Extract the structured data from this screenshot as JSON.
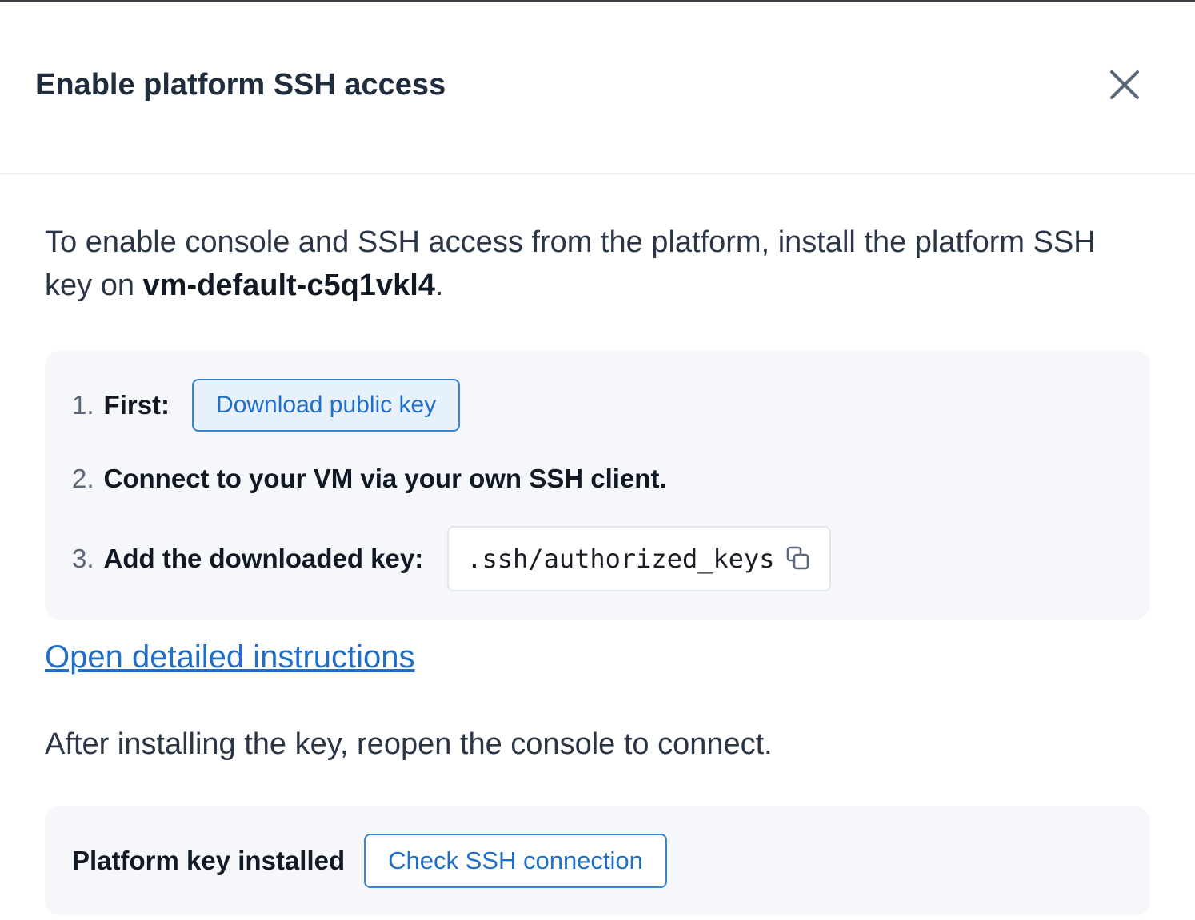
{
  "dialog": {
    "title": "Enable platform SSH access",
    "close_icon": "close-icon"
  },
  "intro": {
    "text_before": "To enable console and SSH access from the platform, install the platform SSH key on ",
    "vm_name": "vm-default-c5q1vkl4",
    "text_after": "."
  },
  "steps": [
    {
      "number": "1.",
      "label": "First:",
      "button_label": "Download public key"
    },
    {
      "number": "2.",
      "label": "Connect to your VM via your own SSH client."
    },
    {
      "number": "3.",
      "label": "Add the downloaded key:",
      "code": ".ssh/authorized_keys",
      "copy_icon": "copy-icon"
    }
  ],
  "instructions_link": "Open detailed instructions",
  "after_text": "After installing the key, reopen the console to connect.",
  "footer": {
    "label": "Platform key installed",
    "button_label": "Check SSH connection"
  },
  "colors": {
    "accent": "#1f6fc9",
    "accent_border": "#3a82d6",
    "panel_bg": "#f5f7fa"
  }
}
